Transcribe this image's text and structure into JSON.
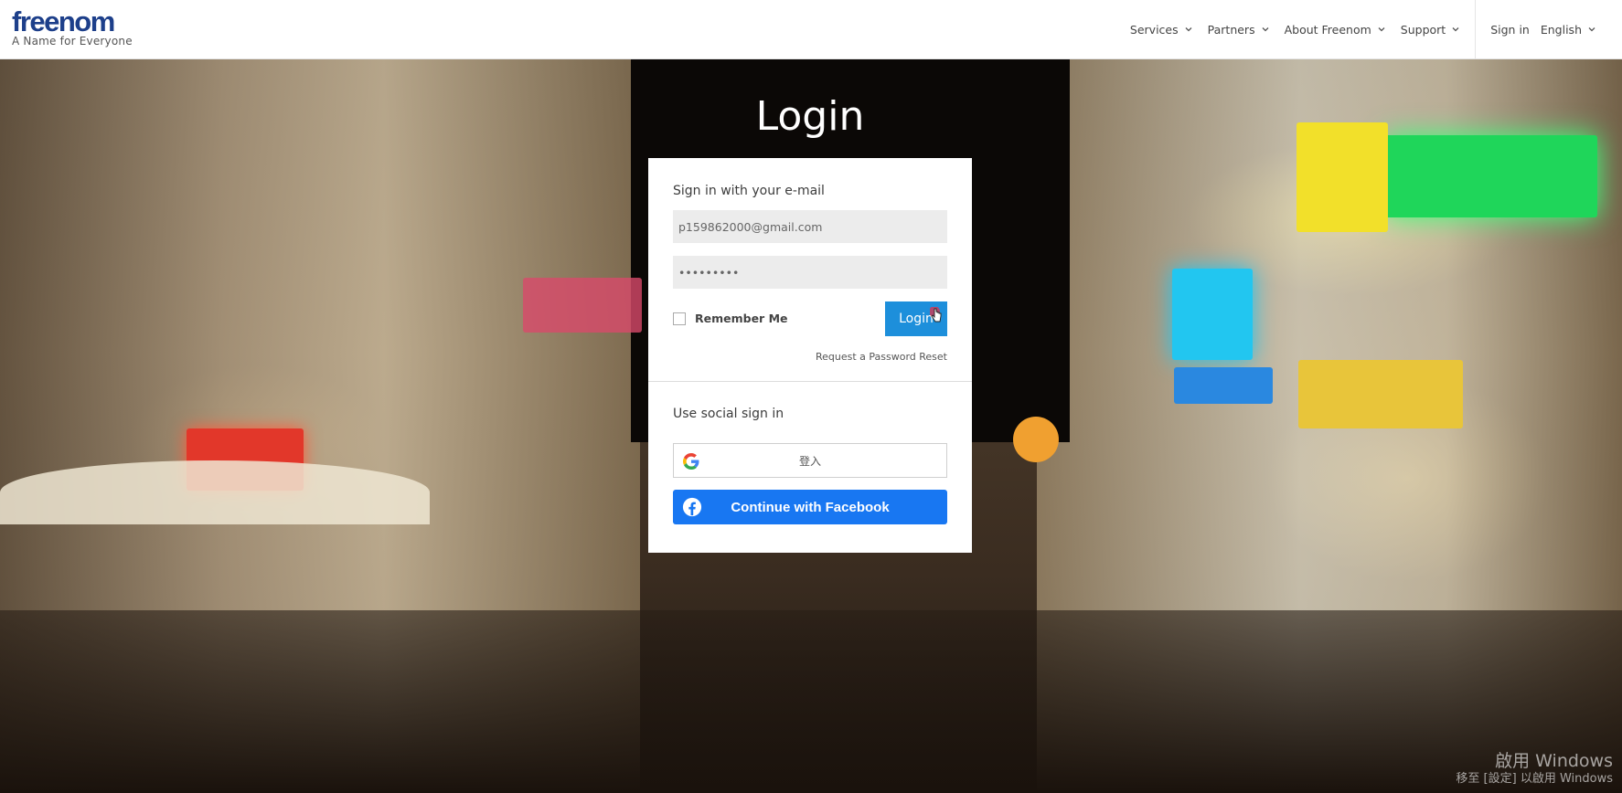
{
  "header": {
    "logo_text": "freenom",
    "tagline": "A Name for Everyone",
    "nav": [
      {
        "label": "Services"
      },
      {
        "label": "Partners"
      },
      {
        "label": "About Freenom"
      },
      {
        "label": "Support"
      }
    ],
    "sign_in": "Sign in",
    "language": "English"
  },
  "login": {
    "title": "Login",
    "email_section_label": "Sign in with your e-mail",
    "email_value": "p159862000@gmail.com",
    "password_value": "•••••••••",
    "remember_label": "Remember Me",
    "login_button": "Login",
    "reset_link": "Request a Password Reset",
    "social_label": "Use social sign in",
    "google_label": "登入",
    "facebook_label": "Continue with Facebook"
  },
  "watermark": {
    "line1": "啟用 Windows",
    "line2": "移至 [設定] 以啟用 Windows"
  },
  "colors": {
    "brand": "#1d3f8a",
    "login_button": "#1d8fdb",
    "facebook": "#1877f2"
  }
}
